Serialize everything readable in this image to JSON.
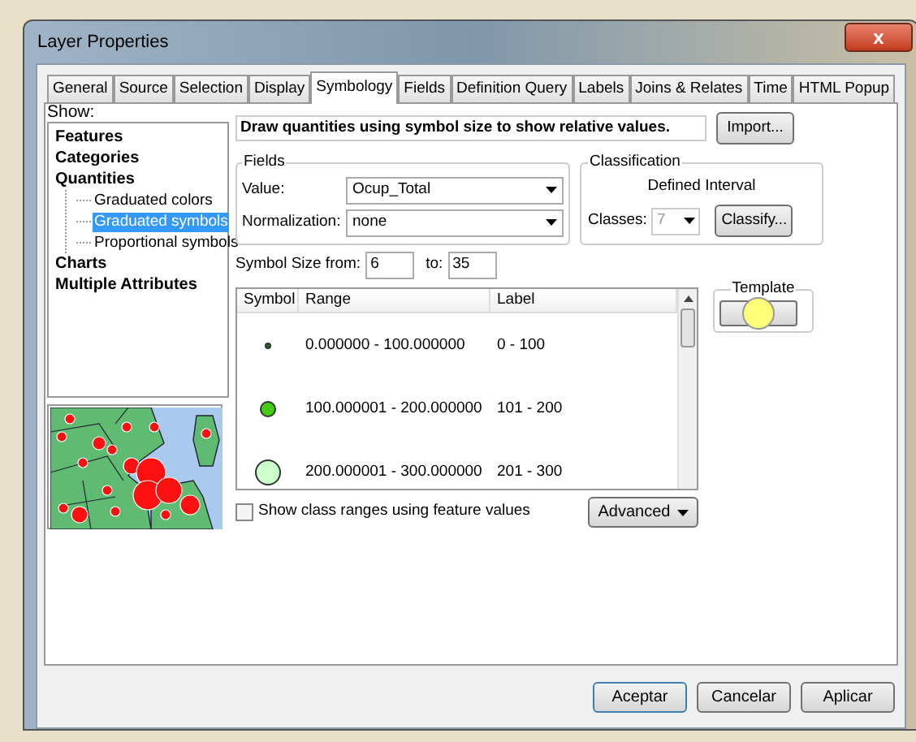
{
  "window": {
    "title": "Layer Properties",
    "close": "x"
  },
  "tabs": [
    {
      "label": "General",
      "selected": false
    },
    {
      "label": "Source",
      "selected": false
    },
    {
      "label": "Selection",
      "selected": false
    },
    {
      "label": "Display",
      "selected": false
    },
    {
      "label": "Symbology",
      "selected": true
    },
    {
      "label": "Fields",
      "selected": false
    },
    {
      "label": "Definition Query",
      "selected": false
    },
    {
      "label": "Labels",
      "selected": false
    },
    {
      "label": "Joins & Relates",
      "selected": false
    },
    {
      "label": "Time",
      "selected": false
    },
    {
      "label": "HTML Popup",
      "selected": false
    }
  ],
  "show": {
    "label": "Show:",
    "items": [
      {
        "label": "Features",
        "selected": false
      },
      {
        "label": "Categories",
        "selected": false
      },
      {
        "label": "Quantities",
        "selected": false,
        "children": [
          {
            "label": "Graduated colors",
            "selected": false
          },
          {
            "label": "Graduated symbols",
            "selected": true
          },
          {
            "label": "Proportional symbols",
            "selected": false
          }
        ]
      },
      {
        "label": "Charts",
        "selected": false
      },
      {
        "label": "Multiple Attributes",
        "selected": false
      }
    ]
  },
  "description": "Draw quantities using symbol size to show relative values.",
  "import_button": "Import...",
  "fields": {
    "title": "Fields",
    "value_label": "Value:",
    "value": "Ocup_Total",
    "normalization_label": "Normalization:",
    "normalization": "none"
  },
  "classification": {
    "title": "Classification",
    "method": "Defined Interval",
    "classes_label": "Classes:",
    "classes": "7",
    "classes_disabled": true,
    "classify_button": "Classify..."
  },
  "symbol_size": {
    "from_label": "Symbol Size from:",
    "from": "6",
    "to_label": "to:",
    "to": "35"
  },
  "table": {
    "columns": [
      "Symbol",
      "Range",
      "Label"
    ],
    "rows": [
      {
        "color": "#1f6b1f",
        "range": "0.000000 - 100.000000",
        "label": "0 - 100"
      },
      {
        "color": "#44cc11",
        "range": "100.000001 - 200.000000",
        "label": "101 - 200"
      },
      {
        "color": "#ccffcc",
        "range": "200.000001 - 300.000000",
        "label": "201 - 300"
      }
    ]
  },
  "template": {
    "title": "Template",
    "color": "#ffff77"
  },
  "show_class_ranges": {
    "label": "Show class ranges using feature values",
    "checked": false
  },
  "advanced_button": "Advanced",
  "buttons": [
    "Aceptar",
    "Cancelar",
    "Aplicar"
  ]
}
